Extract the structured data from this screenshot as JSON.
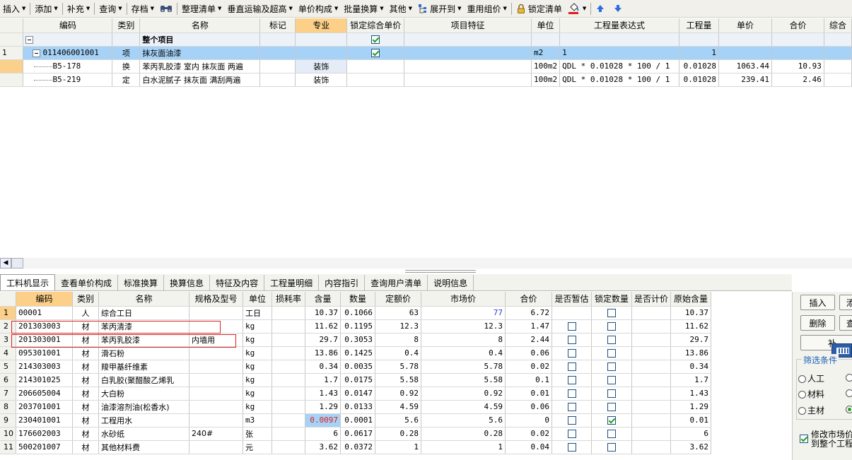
{
  "toolbar": {
    "items": [
      "插入",
      "添加",
      "补充",
      "查询",
      "存档",
      "整理清单",
      "垂直运输及超高",
      "单价构成",
      "批量换算",
      "其他",
      "展开到",
      "重用组价",
      "锁定清单"
    ]
  },
  "upper": {
    "headers": [
      "编码",
      "类别",
      "名称",
      "标记",
      "专业",
      "锁定综合单价",
      "项目特征",
      "单位",
      "工程量表达式",
      "工程量",
      "单价",
      "合价",
      "综合"
    ],
    "rows": [
      {
        "rn": "",
        "code": "",
        "type": "",
        "name": "整个项目",
        "mark": "",
        "major": "",
        "lock": true,
        "feature": "",
        "unit": "",
        "expr": "",
        "qty": "",
        "price": "",
        "total": ""
      },
      {
        "rn": "1",
        "code": "011406001001",
        "type": "项",
        "name": "抹灰面油漆",
        "mark": "",
        "major": "",
        "lock": true,
        "feature": "",
        "unit": "m2",
        "expr": "1",
        "qty": "1",
        "price": "",
        "total": ""
      },
      {
        "rn": "",
        "code": "B5-178",
        "type": "换",
        "name": "苯丙乳胶漆 室内 抹灰面 两遍",
        "mark": "",
        "major": "装饰",
        "lock": false,
        "feature": "",
        "unit": "100m2",
        "expr": "QDL * 0.01028  * 100 / 1",
        "qty": "0.01028",
        "price": "1063.44",
        "total": "10.93"
      },
      {
        "rn": "",
        "code": "B5-219",
        "type": "定",
        "name": "白水泥腻子 抹灰面 满刮两遍",
        "mark": "",
        "major": "装饰",
        "lock": false,
        "feature": "",
        "unit": "100m2",
        "expr": "QDL * 0.01028  * 100 / 1",
        "qty": "0.01028",
        "price": "239.41",
        "total": "2.46"
      }
    ]
  },
  "tabs": [
    "工料机显示",
    "查看单价构成",
    "标准换算",
    "换算信息",
    "特征及内容",
    "工程量明细",
    "内容指引",
    "查询用户清单",
    "说明信息"
  ],
  "lower": {
    "headers": [
      "编码",
      "类别",
      "名称",
      "规格及型号",
      "单位",
      "损耗率",
      "含量",
      "数量",
      "定额价",
      "市场价",
      "合价",
      "是否暂估",
      "锁定数量",
      "是否计价",
      "原始含量"
    ],
    "rows": [
      {
        "rn": "1",
        "code": "00001",
        "type": "人",
        "name": "综合工日",
        "spec": "",
        "unit": "工日",
        "loss": "",
        "content": "10.37",
        "qty": "0.1066",
        "fixed": "63",
        "market": "77",
        "total": "6.72",
        "est": null,
        "lockq": false,
        "priced": null,
        "orig": "10.37"
      },
      {
        "rn": "2",
        "code": "201303003",
        "type": "材",
        "name": "苯丙清漆",
        "spec": "",
        "unit": "kg",
        "loss": "",
        "content": "11.62",
        "qty": "0.1195",
        "fixed": "12.3",
        "market": "12.3",
        "total": "1.47",
        "est": false,
        "lockq": false,
        "priced": null,
        "orig": "11.62"
      },
      {
        "rn": "3",
        "code": "201303001",
        "type": "材",
        "name": "苯丙乳胶漆",
        "spec": "内墙用",
        "unit": "kg",
        "loss": "",
        "content": "29.7",
        "qty": "0.3053",
        "fixed": "8",
        "market": "8",
        "total": "2.44",
        "est": false,
        "lockq": false,
        "priced": null,
        "orig": "29.7"
      },
      {
        "rn": "4",
        "code": "095301001",
        "type": "材",
        "name": "滑石粉",
        "spec": "",
        "unit": "kg",
        "loss": "",
        "content": "13.86",
        "qty": "0.1425",
        "fixed": "0.4",
        "market": "0.4",
        "total": "0.06",
        "est": false,
        "lockq": false,
        "priced": null,
        "orig": "13.86"
      },
      {
        "rn": "5",
        "code": "214303003",
        "type": "材",
        "name": "羧甲基纤维素",
        "spec": "",
        "unit": "kg",
        "loss": "",
        "content": "0.34",
        "qty": "0.0035",
        "fixed": "5.78",
        "market": "5.78",
        "total": "0.02",
        "est": false,
        "lockq": false,
        "priced": null,
        "orig": "0.34"
      },
      {
        "rn": "6",
        "code": "214301025",
        "type": "材",
        "name": "白乳胶(聚醋酸乙烯乳",
        "spec": "",
        "unit": "kg",
        "loss": "",
        "content": "1.7",
        "qty": "0.0175",
        "fixed": "5.58",
        "market": "5.58",
        "total": "0.1",
        "est": false,
        "lockq": false,
        "priced": null,
        "orig": "1.7"
      },
      {
        "rn": "7",
        "code": "206605004",
        "type": "材",
        "name": "大白粉",
        "spec": "",
        "unit": "kg",
        "loss": "",
        "content": "1.43",
        "qty": "0.0147",
        "fixed": "0.92",
        "market": "0.92",
        "total": "0.01",
        "est": false,
        "lockq": false,
        "priced": null,
        "orig": "1.43"
      },
      {
        "rn": "8",
        "code": "203701001",
        "type": "材",
        "name": "油漆溶剂油(松香水)",
        "spec": "",
        "unit": "kg",
        "loss": "",
        "content": "1.29",
        "qty": "0.0133",
        "fixed": "4.59",
        "market": "4.59",
        "total": "0.06",
        "est": false,
        "lockq": false,
        "priced": null,
        "orig": "1.29"
      },
      {
        "rn": "9",
        "code": "230401001",
        "type": "材",
        "name": "工程用水",
        "spec": "",
        "unit": "m3",
        "loss": "",
        "content": "0.0097",
        "qty": "0.0001",
        "fixed": "5.6",
        "market": "5.6",
        "total": "0",
        "est": false,
        "lockq": true,
        "priced": null,
        "orig": "0.01"
      },
      {
        "rn": "10",
        "code": "176602003",
        "type": "材",
        "name": "水砂纸",
        "spec": "240#",
        "unit": "张",
        "loss": "",
        "content": "6",
        "qty": "0.0617",
        "fixed": "0.28",
        "market": "0.28",
        "total": "0.02",
        "est": false,
        "lockq": false,
        "priced": null,
        "orig": "6"
      },
      {
        "rn": "11",
        "code": "500201007",
        "type": "材",
        "name": "其他材料费",
        "spec": "",
        "unit": "元",
        "loss": "",
        "content": "3.62",
        "qty": "0.0372",
        "fixed": "1",
        "market": "1",
        "total": "0.04",
        "est": false,
        "lockq": false,
        "priced": null,
        "orig": "3.62"
      }
    ]
  },
  "rpanel": {
    "insert": "插入",
    "add_partial": "添",
    "delete": "删除",
    "query_partial": "查",
    "supplement_partial": "补",
    "filter_title": "筛选条件",
    "radio_labor": "人工",
    "radio_material": "材料",
    "radio_main": "主材",
    "modify_line1": "修改市场价",
    "modify_line2": "到整个工程"
  }
}
